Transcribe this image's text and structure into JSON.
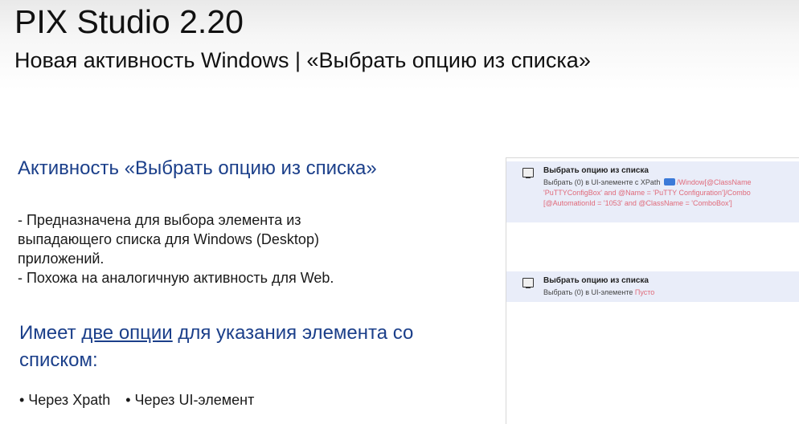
{
  "header": {
    "title": "PIX Studio 2.20",
    "subtitle": "Новая активность Windows | «Выбрать опцию из списка»"
  },
  "content": {
    "heading": "Активность «Выбрать опцию из списка»",
    "desc_lines": [
      "- Предназначена для выбора элемента из",
      "выпадающего списка для Windows (Desktop)",
      "приложений.",
      "- Похожа на аналогичную активность для Web."
    ],
    "options_prefix": "Имеет ",
    "options_underlined": "две опции",
    "options_suffix": " для указания элемента со списком:",
    "bullet_1": "• Через Xpath",
    "bullet_2": "• Через UI-элемент"
  },
  "panel": {
    "activity_1": {
      "title": "Выбрать опцию из списка",
      "line1_prefix": "Выбрать (0) в UI-элементе с XPath",
      "line1_value": "/Window[@ClassName",
      "line2": "'PuTTYConfigBox' and @Name = 'PuTTY Configuration']/Combo",
      "line3": "[@AutomationId = '1053' and @ClassName = 'ComboBox']"
    },
    "activity_2": {
      "title": "Выбрать опцию из списка",
      "line_prefix": "Выбрать (0) в UI-элементе",
      "line_value": "Пусто"
    }
  },
  "colors": {
    "heading_blue": "#1b3f8a",
    "activity_bg": "#e9edf9",
    "value_red": "#e06a7a"
  }
}
